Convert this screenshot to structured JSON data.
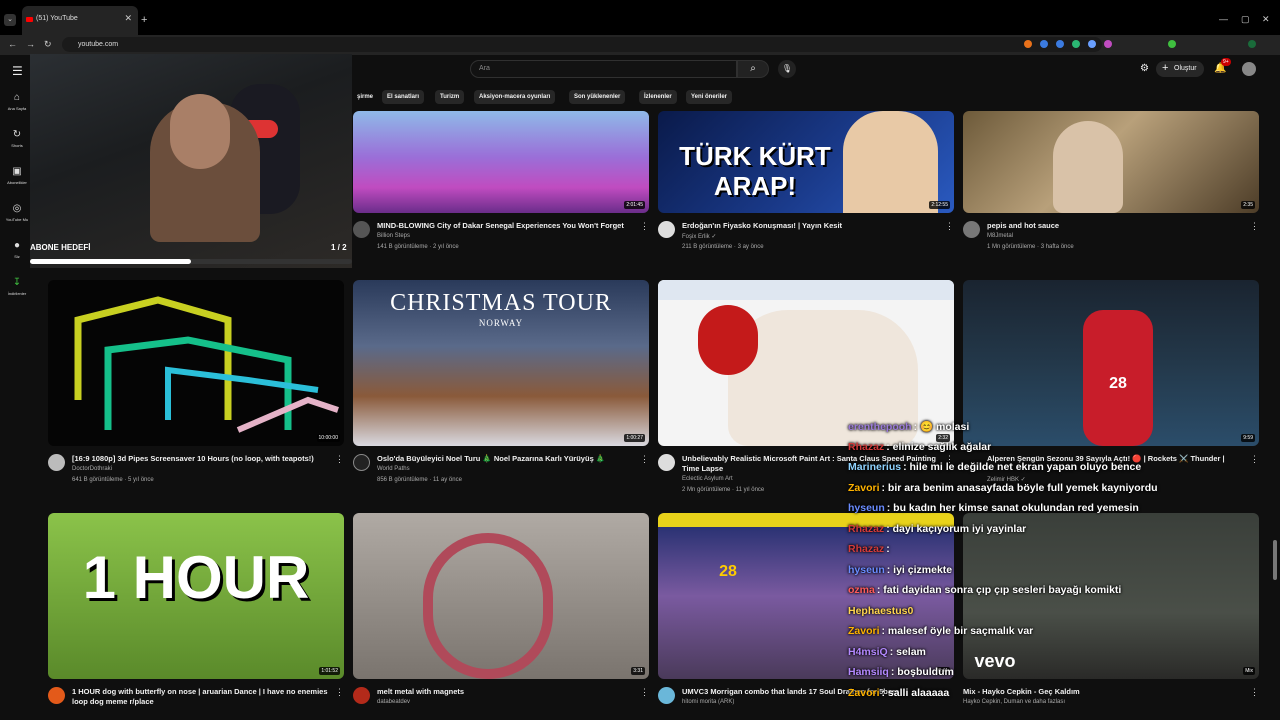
{
  "browser": {
    "tab_title": "(51) YouTube",
    "tab_close": "✕",
    "new_tab": "+",
    "url": "youtube.com"
  },
  "header": {
    "search_placeholder": "Ara",
    "create_label": "Oluştur",
    "notif_badge": "9+"
  },
  "chips": [
    "şirme",
    "El sanatları",
    "Turizm",
    "Aksiyon-macera oyunları",
    "Son yüklenenler",
    "İzlenenler",
    "Yeni öneriler"
  ],
  "sidebar": [
    {
      "label": "Ana Sayfa",
      "icon": "⌂"
    },
    {
      "label": "Shorts",
      "icon": "↻"
    },
    {
      "label": "Abonelikler",
      "icon": "▣"
    },
    {
      "label": "YouTube Mu",
      "icon": "◎"
    },
    {
      "label": "Siz",
      "icon": "●"
    },
    {
      "label": "İndirilenler",
      "icon": "↧"
    }
  ],
  "overlay": {
    "goal_label": "ABONE HEDEFİ",
    "goal_count": "1 / 2",
    "goal_progress": 0.5
  },
  "videos": [
    {
      "title": "MIND-BLOWING City of Dakar Senegal Experiences You Won't Forget",
      "channel": "Billion Steps",
      "meta": "141 B görüntüleme · 2 yıl önce",
      "duration": "2:01:45"
    },
    {
      "title": "Erdoğan'ın Fiyasko Konuşması! | Yayın Kesit",
      "channel": "Foşix Erlik ✓",
      "meta": "211 B görüntüleme · 3 ay önce",
      "duration": "2:12:55",
      "thumb_text": "TÜRK KÜRT ARAP!"
    },
    {
      "title": "pepis and hot sauce",
      "channel": "M8Jmetal",
      "meta": "1 Mn görüntüleme · 3 hafta önce",
      "duration": "2:35"
    },
    {
      "title": "[16:9 1080p] 3d Pipes Screensaver 10 Hours (no loop, with teapots!)",
      "channel": "DoctorDothraki",
      "meta": "641 B görüntüleme · 5 yıl önce",
      "duration": "10:00:00"
    },
    {
      "title": "Oslo'da Büyüleyici Noel Turu 🎄 Noel Pazarına Karlı Yürüyüş 🎄",
      "channel": "World Paths",
      "meta": "856 B görüntüleme · 11 ay önce",
      "duration": "1:00:27",
      "thumb_text": "CHRISTMAS TOUR",
      "thumb_sub": "NORWAY"
    },
    {
      "title": "Unbelievably Realistic Microsoft Paint Art : Santa Claus Speed Painting Time Lapse",
      "channel": "Eclectic Asylum Art",
      "meta": "2 Mn görüntüleme · 11 yıl önce",
      "duration": "2:32"
    },
    {
      "title": "Alperen Şengün Sezonu 39 Sayıyla Açtı! 🔴 | Rockets ⚔️ Thunder |",
      "channel": "Zelimir HBK ✓",
      "meta": "",
      "duration": "9:59"
    },
    {
      "title": "1 HOUR dog with butterfly on nose | aruarian Dance | I have no enemies loop dog meme r/place",
      "channel": "",
      "meta": "",
      "duration": "1:01:52",
      "thumb_text": "1 HOUR"
    },
    {
      "title": "melt metal with magnets",
      "channel": "databeatdev",
      "meta": "",
      "duration": "3:31"
    },
    {
      "title": "UMVC3 Morrigan combo that lands 17 Soul Draines for 5bars",
      "channel": "hitomi morita (ARK)",
      "meta": "",
      "duration": "0:41"
    },
    {
      "title": "Mix - Hayko Cepkin - Geç Kaldım",
      "channel": "Hayko Cepkin, Duman ve daha fazlası",
      "meta": "",
      "duration": "Mix",
      "thumb_text": "vevo"
    }
  ],
  "chat": [
    {
      "user": "erenthepooh",
      "text": ": 😊 molasi",
      "color": "#9b7bd9"
    },
    {
      "user": "Rhazaz",
      "text": ": elinize sağlık ağalar",
      "color": "#d33a3a"
    },
    {
      "user": "Marinerius",
      "text": ": hile mi le değilde net ekran yapan oluyo bence",
      "color": "#8fd3ff"
    },
    {
      "user": "Zavori",
      "text": ": bir ara benim anasayfada böyle full yemek kayniyordu",
      "color": "#ffb300"
    },
    {
      "user": "hyseun",
      "text": ": bu kadın her kimse sanat okulundan red yemesin",
      "color": "#6a8cff"
    },
    {
      "user": "Rhazaz",
      "text": ": dayi kaçıyorum iyi yayinlar",
      "color": "#d33a3a"
    },
    {
      "user": "Rhazaz",
      "text": ": ",
      "color": "#d33a3a"
    },
    {
      "user": "hyseun",
      "text": ": iyi çizmekte",
      "color": "#6a8cff"
    },
    {
      "user": "ozmа",
      "text": ": fati dayidan sonra çıp çıp sesleri bayağı komikti",
      "color": "#ff5a5a"
    },
    {
      "user": "Hephaestus0",
      "text": "",
      "color": "#ffd54f"
    },
    {
      "user": "Zavori",
      "text": ": malesef öyle bir saçmalık var",
      "color": "#ffb300"
    },
    {
      "user": "H4msiQ",
      "text": ": selam",
      "color": "#b388ff"
    },
    {
      "user": "Hamsiiq",
      "text": ": boşbuldum",
      "color": "#b388ff"
    },
    {
      "user": "Zavori",
      "text": ": salli alaaaaa",
      "color": "#ffb300"
    }
  ]
}
